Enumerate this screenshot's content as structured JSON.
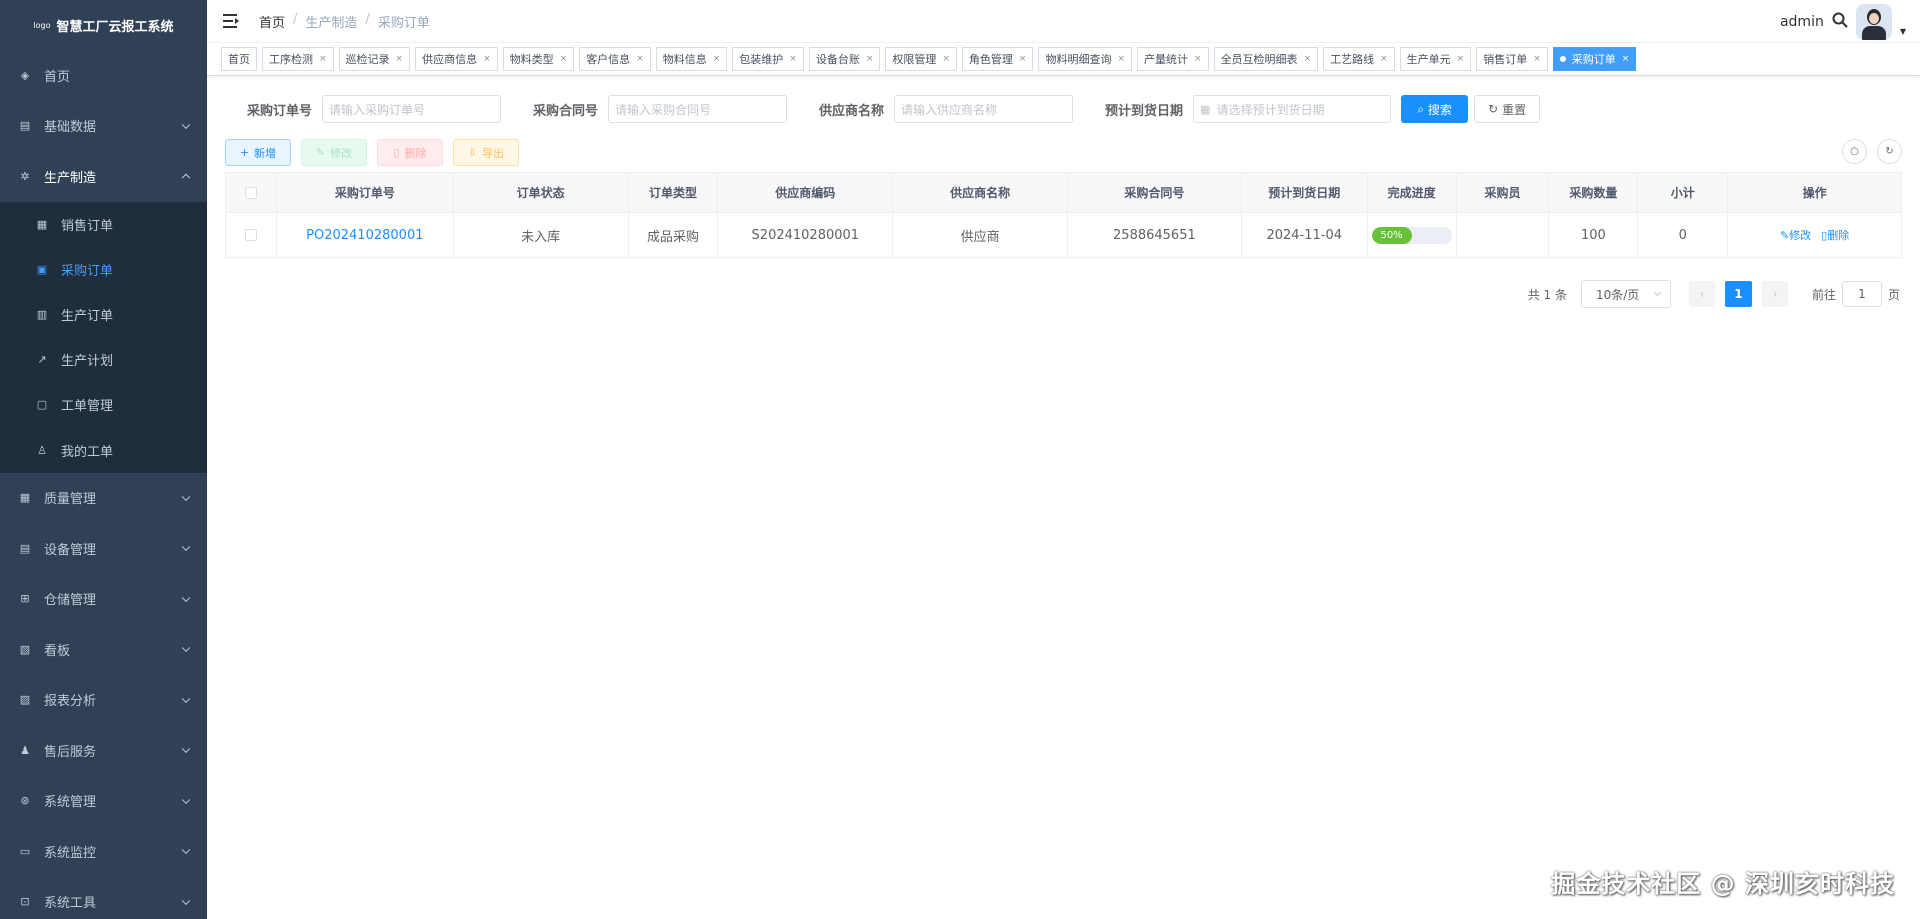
{
  "app": {
    "title": "智慧工厂云报工系统",
    "logo_text": "logo"
  },
  "sidebar": {
    "items_top": [
      {
        "label": "首页",
        "icon": "dashboard-icon"
      },
      {
        "label": "基础数据",
        "icon": "database-icon"
      },
      {
        "label": "生产制造",
        "icon": "cogs-icon"
      }
    ],
    "sub_items": [
      {
        "label": "销售订单",
        "icon": "document-icon"
      },
      {
        "label": "采购订单",
        "icon": "copy-icon"
      },
      {
        "label": "生产订单",
        "icon": "chart-icon"
      },
      {
        "label": "生产计划",
        "icon": "share-icon"
      },
      {
        "label": "工单管理",
        "icon": "monitor-icon"
      },
      {
        "label": "我的工单",
        "icon": "users-icon"
      }
    ],
    "items_bottom": [
      {
        "label": "质量管理",
        "icon": "grid-icon"
      },
      {
        "label": "设备管理",
        "icon": "device-icon"
      },
      {
        "label": "仓储管理",
        "icon": "cart-icon"
      },
      {
        "label": "看板",
        "icon": "board-icon"
      },
      {
        "label": "报表分析",
        "icon": "report-icon"
      },
      {
        "label": "售后服务",
        "icon": "service-icon"
      },
      {
        "label": "系统管理",
        "icon": "system-icon"
      },
      {
        "label": "系统监控",
        "icon": "monitor-icon"
      },
      {
        "label": "系统工具",
        "icon": "tool-icon"
      }
    ]
  },
  "header": {
    "breadcrumb": [
      "首页",
      "生产制造",
      "采购订单"
    ],
    "username": "admin"
  },
  "tags": [
    {
      "label": "首页",
      "closable": false
    },
    {
      "label": "工序检测",
      "closable": true
    },
    {
      "label": "巡检记录",
      "closable": true
    },
    {
      "label": "供应商信息",
      "closable": true
    },
    {
      "label": "物料类型",
      "closable": true
    },
    {
      "label": "客户信息",
      "closable": true
    },
    {
      "label": "物料信息",
      "closable": true
    },
    {
      "label": "包装维护",
      "closable": true
    },
    {
      "label": "设备台账",
      "closable": true
    },
    {
      "label": "权限管理",
      "closable": true
    },
    {
      "label": "角色管理",
      "closable": true
    },
    {
      "label": "物料明细查询",
      "closable": true
    },
    {
      "label": "产量统计",
      "closable": true
    },
    {
      "label": "全员互检明细表",
      "closable": true
    },
    {
      "label": "工艺路线",
      "closable": true
    },
    {
      "label": "生产单元",
      "closable": true
    },
    {
      "label": "销售订单",
      "closable": true
    },
    {
      "label": "采购订单",
      "closable": true,
      "active": true
    }
  ],
  "search": {
    "order_no_label": "采购订单号",
    "order_no_placeholder": "请输入采购订单号",
    "contract_label": "采购合同号",
    "contract_placeholder": "请输入采购合同号",
    "supplier_label": "供应商名称",
    "supplier_placeholder": "请输入供应商名称",
    "date_label": "预计到货日期",
    "date_placeholder": "请选择预计到货日期",
    "search_btn": "搜索",
    "reset_btn": "重置"
  },
  "toolbar": {
    "add": "新增",
    "edit": "修改",
    "delete": "删除",
    "export": "导出"
  },
  "table": {
    "columns": [
      "采购订单号",
      "订单状态",
      "订单类型",
      "供应商编码",
      "供应商名称",
      "采购合同号",
      "预计到货日期",
      "完成进度",
      "采购员",
      "采购数量",
      "小计",
      "操作"
    ],
    "rows": [
      {
        "order_no": "PO202410280001",
        "status": "未入库",
        "type": "成品采购",
        "supplier_code": "S202410280001",
        "supplier_name": "供应商",
        "contract_no": "2588645651",
        "eta": "2024-11-04",
        "progress": 50,
        "progress_label": "50%",
        "buyer": "",
        "qty": "100",
        "subtotal": "0",
        "op_edit": "修改",
        "op_delete": "删除"
      }
    ]
  },
  "pagination": {
    "total": "共 1 条",
    "page_size": "10条/页",
    "current": "1",
    "goto_label": "前往",
    "goto_value": "1",
    "page_suffix": "页"
  },
  "watermark": "掘金技术社区 @ 深圳亥时科技",
  "colors": {
    "sidebar": "#304156",
    "submenu": "#1f2d3d",
    "primary": "#1890ff",
    "success": "#67c23a"
  }
}
